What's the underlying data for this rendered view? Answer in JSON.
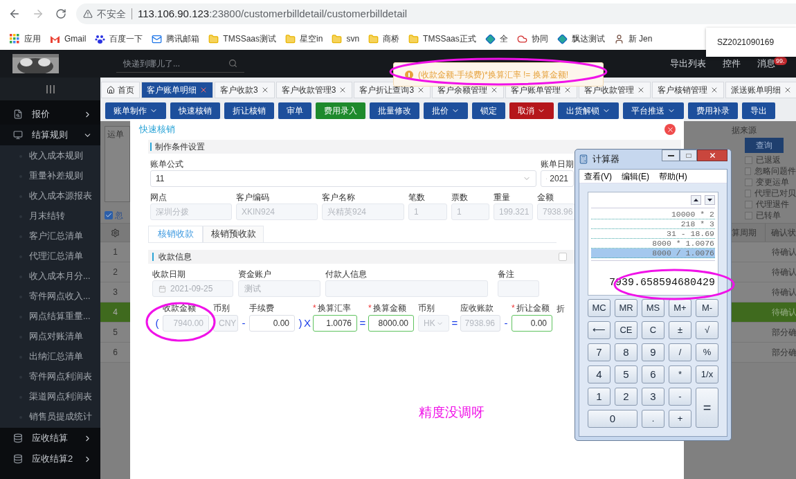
{
  "browser": {
    "security": "不安全",
    "url_host": "113.106.90.123",
    "url_path": ":23800/customerbilldetail/customerbilldetail",
    "bookmarks": [
      {
        "kind": "apps",
        "label": "应用"
      },
      {
        "kind": "gmail",
        "label": "Gmail"
      },
      {
        "kind": "baidu",
        "label": "百度一下"
      },
      {
        "kind": "mail",
        "label": "腾讯邮箱"
      },
      {
        "kind": "folder",
        "label": "TMSSaas测试"
      },
      {
        "kind": "folder",
        "label": "星空in"
      },
      {
        "kind": "folder",
        "label": "svn"
      },
      {
        "kind": "folder",
        "label": "商桥"
      },
      {
        "kind": "folder",
        "label": "TMSSaas正式"
      },
      {
        "kind": "diamond",
        "label": "全"
      },
      {
        "kind": "cloud",
        "label": "协同"
      },
      {
        "kind": "diamond",
        "label": "飘达测试"
      },
      {
        "kind": "avatar",
        "label": "新 Jen"
      }
    ]
  },
  "suggestion": "SZ2021090169",
  "header": {
    "search_placeholder": "快递到哪儿了...",
    "links": [
      "导出列表",
      "控件",
      "消息"
    ],
    "badge": "99."
  },
  "sidebar": [
    {
      "label": "报价",
      "expanded": false
    },
    {
      "label": "结算规则",
      "expanded": true,
      "children": [
        "收入成本规则",
        "重量补差规则",
        "收入成本源报表",
        "月末结转",
        "客户汇总清单",
        "代理汇总清单",
        "收入成本月分...",
        "寄件网点收入...",
        "网点结算重量...",
        "网点对账清单",
        "出纳汇总清单",
        "寄件网点利润表",
        "渠道网点利润表",
        "销售员提成统计"
      ]
    },
    {
      "label": "应收结算",
      "expanded": false
    },
    {
      "label": "应收结算2",
      "expanded": false
    }
  ],
  "tabs": [
    {
      "label": "首页",
      "selected": false,
      "closable": false
    },
    {
      "label": "客户账单明细",
      "selected": true,
      "closable": true
    },
    {
      "label": "客户收款3",
      "selected": false,
      "closable": true
    },
    {
      "label": "客户收款管理3",
      "selected": false,
      "closable": true
    },
    {
      "label": "客户折让查询3",
      "selected": false,
      "closable": true
    },
    {
      "label": "客户余额管理",
      "selected": false,
      "closable": true
    },
    {
      "label": "客户账单管理",
      "selected": false,
      "closable": true
    },
    {
      "label": "客户收款管理",
      "selected": false,
      "closable": true
    },
    {
      "label": "客户核销管理",
      "selected": false,
      "closable": true
    },
    {
      "label": "派送账单明细",
      "selected": false,
      "closable": true
    }
  ],
  "toolbar": [
    {
      "label": "账单制作",
      "kind": "primary",
      "menu": true
    },
    {
      "label": "快速核销",
      "kind": "primary",
      "menu": false
    },
    {
      "label": "折让核销",
      "kind": "primary",
      "menu": false
    },
    {
      "label": "审单",
      "kind": "primary",
      "menu": false
    },
    {
      "label": "费用录入",
      "kind": "success",
      "menu": false
    },
    {
      "label": "批量修改",
      "kind": "primary",
      "menu": false
    },
    {
      "label": "批价",
      "kind": "primary",
      "menu": true
    },
    {
      "label": "锁定",
      "kind": "primary",
      "menu": false
    },
    {
      "label": "取消",
      "kind": "danger",
      "menu": true
    },
    {
      "label": "出货解锁",
      "kind": "primary",
      "menu": true
    },
    {
      "label": "平台推送",
      "kind": "primary",
      "menu": true
    },
    {
      "label": "费用补录",
      "kind": "primary",
      "menu": false
    },
    {
      "label": "导出",
      "kind": "primary",
      "menu": false
    }
  ],
  "toast": "(收款金额-手续费)*换算汇率 != 换算金额!",
  "background": {
    "waybill_label": "运单",
    "ignore": {
      "label": "忽",
      "checked": true
    },
    "source_label": "据来源",
    "query_button": "查询",
    "filters": [
      {
        "label": "已退返",
        "checked": false
      },
      {
        "label": "忽略问题件",
        "checked": false
      },
      {
        "label": "变更运单",
        "checked": false
      },
      {
        "label": "代理已对贝",
        "checked": false
      },
      {
        "label": "代理退件",
        "checked": false
      },
      {
        "label": "已转单",
        "checked": false
      }
    ],
    "columns": [
      "算周期",
      "确认状"
    ],
    "rows": [
      {
        "no": "1",
        "status": "待确认",
        "selected": false
      },
      {
        "no": "2",
        "status": "待确认",
        "selected": false
      },
      {
        "no": "3",
        "status": "待确认",
        "selected": false
      },
      {
        "no": "4",
        "status": "待确认",
        "selected": true
      },
      {
        "no": "5",
        "status": "部分确",
        "selected": false
      },
      {
        "no": "6",
        "status": "部分确",
        "selected": false
      }
    ]
  },
  "dialog": {
    "title": "快速核销",
    "section1": "制作条件设置",
    "formula_label": "账单公式",
    "formula_value": "11",
    "date_label": "账单日期",
    "date_value": "2021",
    "info": [
      {
        "label": "网点",
        "value": "深圳分拨"
      },
      {
        "label": "客户编码",
        "value": "XKIN924"
      },
      {
        "label": "客户名称",
        "value": "兴精英924"
      },
      {
        "label": "笔数",
        "value": "1"
      },
      {
        "label": "票数",
        "value": "1"
      },
      {
        "label": "重量",
        "value": "199.321"
      },
      {
        "label": "金额",
        "value": "7938.96"
      }
    ],
    "tabs": [
      {
        "label": "核销收款",
        "selected": true
      },
      {
        "label": "核销预收款",
        "selected": false
      }
    ],
    "section2": "收款信息",
    "section2_checked": false,
    "receipt": [
      {
        "label": "收款日期",
        "value": "2021-09-25",
        "kind": "date"
      },
      {
        "label": "资金账户",
        "value": "测试",
        "kind": "text"
      },
      {
        "label": "付款人信息",
        "kind": "text"
      },
      {
        "label": "备注",
        "kind": "text"
      }
    ],
    "calc_row": [
      {
        "kind": "op",
        "text": "("
      },
      {
        "kind": "field",
        "label": "收款金额",
        "value": "7940.00",
        "required": false,
        "disabled": true,
        "valid": false
      },
      {
        "kind": "field",
        "label": "币别",
        "value": "CNY",
        "required": false,
        "disabled": true,
        "valid": false
      },
      {
        "kind": "op",
        "text": "-"
      },
      {
        "kind": "field",
        "label": "手续费",
        "value": "0.00",
        "required": false,
        "disabled": false,
        "valid": false
      },
      {
        "kind": "op",
        "text": ")"
      },
      {
        "kind": "op",
        "text": "X"
      },
      {
        "kind": "field",
        "label": "换算汇率",
        "value": "1.0076",
        "required": true,
        "disabled": false,
        "valid": true
      },
      {
        "kind": "op",
        "text": "="
      },
      {
        "kind": "field",
        "label": "换算金额",
        "value": "8000.00",
        "required": true,
        "disabled": false,
        "valid": true
      },
      {
        "kind": "select",
        "label": "币别",
        "value": "HK"
      },
      {
        "kind": "op",
        "text": "="
      },
      {
        "kind": "field",
        "label": "应收账款",
        "value": "7938.96",
        "required": false,
        "disabled": true,
        "valid": false
      },
      {
        "kind": "op",
        "text": "-"
      },
      {
        "kind": "field",
        "label": "折让金额",
        "value": "0.00",
        "required": true,
        "disabled": false,
        "valid": true
      },
      {
        "kind": "stub",
        "label": "折"
      }
    ]
  },
  "calculator": {
    "title": "计算器",
    "menu": [
      "查看(V)",
      "编辑(E)",
      "帮助(H)"
    ],
    "history": [
      {
        "text": "10000 * 2",
        "selected": false
      },
      {
        "text": "218 * 3",
        "selected": false
      },
      {
        "text": "31 - 18.69",
        "selected": false
      },
      {
        "text": "8000 * 1.0076",
        "selected": false
      },
      {
        "text": "8000 / 1.0076",
        "selected": true
      }
    ],
    "result": "7939.658594680429",
    "keys": [
      {
        "text": "MC",
        "kind": "key"
      },
      {
        "text": "MR",
        "kind": "key"
      },
      {
        "text": "MS",
        "kind": "key"
      },
      {
        "text": "M+",
        "kind": "key"
      },
      {
        "text": "M-",
        "kind": "key"
      },
      {
        "text": "⟵",
        "kind": "key"
      },
      {
        "text": "CE",
        "kind": "key"
      },
      {
        "text": "C",
        "kind": "key"
      },
      {
        "text": "±",
        "kind": "key"
      },
      {
        "text": "√",
        "kind": "key"
      },
      {
        "text": "7",
        "kind": "key"
      },
      {
        "text": "8",
        "kind": "key"
      },
      {
        "text": "9",
        "kind": "key"
      },
      {
        "text": "/",
        "kind": "key"
      },
      {
        "text": "%",
        "kind": "key"
      },
      {
        "text": "4",
        "kind": "key"
      },
      {
        "text": "5",
        "kind": "key"
      },
      {
        "text": "6",
        "kind": "key"
      },
      {
        "text": "*",
        "kind": "key"
      },
      {
        "text": "1/x",
        "kind": "key"
      },
      {
        "text": "1",
        "kind": "key"
      },
      {
        "text": "2",
        "kind": "key"
      },
      {
        "text": "3",
        "kind": "key"
      },
      {
        "text": "-",
        "kind": "key"
      },
      {
        "text": "=",
        "kind": "tall"
      },
      {
        "text": "0",
        "kind": "wide"
      },
      {
        "text": ".",
        "kind": "key"
      },
      {
        "text": "+",
        "kind": "key"
      }
    ]
  },
  "annotation": "精度没调呀"
}
